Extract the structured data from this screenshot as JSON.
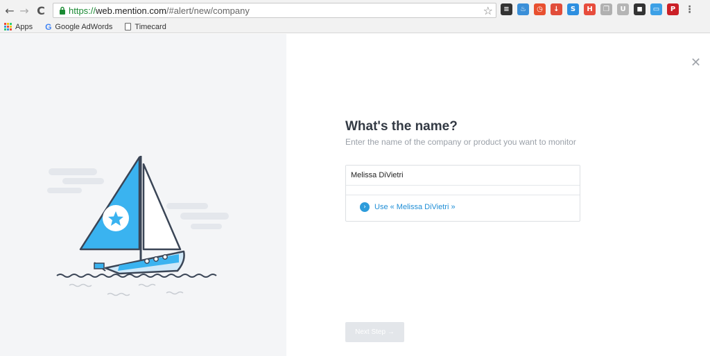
{
  "browser": {
    "back_glyph": "←",
    "forward_glyph": "→",
    "reload_glyph": "C",
    "url_scheme": "https://",
    "url_host": "web.mention.com",
    "url_path": "/#alert/new/company",
    "star_glyph": "☆",
    "extensions": [
      {
        "name": "layers-icon",
        "color": "#333333",
        "glyph": "≡"
      },
      {
        "name": "flame-icon",
        "color": "#3a8fd8",
        "glyph": "♨"
      },
      {
        "name": "clock-icon",
        "color": "#e8502f",
        "glyph": "◷"
      },
      {
        "name": "arrow-down-icon",
        "color": "#e14d3a",
        "glyph": "↓"
      },
      {
        "name": "s-extension-icon",
        "color": "#2d8fe0",
        "glyph": "S"
      },
      {
        "name": "h-extension-icon",
        "color": "#e74c3c",
        "glyph": "H"
      },
      {
        "name": "copy-icon",
        "color": "#b0b0b0",
        "glyph": "❐"
      },
      {
        "name": "u-extension-icon",
        "color": "#b5b5b5",
        "glyph": "U"
      },
      {
        "name": "square-icon",
        "color": "#333333",
        "glyph": "◼"
      },
      {
        "name": "window-icon",
        "color": "#3ca0e6",
        "glyph": "▭"
      },
      {
        "name": "pinterest-icon",
        "color": "#cb2027",
        "glyph": "P"
      },
      {
        "name": "menu-icon",
        "color": "#666666",
        "glyph": "⋮"
      }
    ],
    "bookmarks": {
      "apps_label": "Apps",
      "adwords_label": "Google AdWords",
      "adwords_glyph": "G",
      "timecard_label": "Timecard"
    }
  },
  "page": {
    "close_glyph": "✕",
    "heading": "What's the name?",
    "subheading": "Enter the name of the company or product you want to monitor",
    "name_input_value": "Melissa DiVietri",
    "suggestion_glyph": "›",
    "suggestion_label": "Use « Melissa DiVietri »",
    "next_button_label": "Next Step →"
  },
  "colors": {
    "accent": "#2d9cdb",
    "sail": "#3ab3f0",
    "left_panel_bg": "#f4f5f7"
  }
}
